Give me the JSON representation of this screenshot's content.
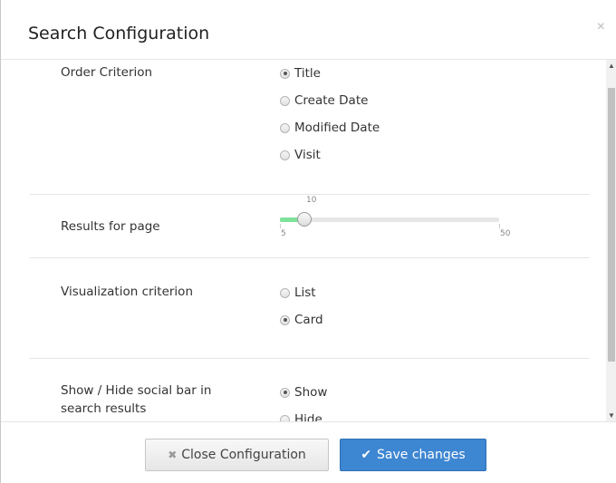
{
  "dialog": {
    "title": "Search Configuration",
    "close_icon": "×"
  },
  "order": {
    "label": "Order Criterion",
    "options": [
      "Title",
      "Create Date",
      "Modified Date",
      "Visit"
    ],
    "selected": "Title"
  },
  "results": {
    "label": "Results for page",
    "value": "10",
    "min": "5",
    "max": "50",
    "fraction": 0.111
  },
  "visualization": {
    "label": "Visualization criterion",
    "options": [
      "List",
      "Card"
    ],
    "selected": "Card"
  },
  "social": {
    "label_line1": "Show / Hide social bar in",
    "label_line2": "search results",
    "options": [
      "Show",
      "Hide"
    ],
    "selected": "Show"
  },
  "footer": {
    "close_label": "Close Configuration",
    "save_label": "Save changes"
  },
  "colors": {
    "primary": "#3d86d2",
    "slider_fill": "#7fe29a"
  }
}
